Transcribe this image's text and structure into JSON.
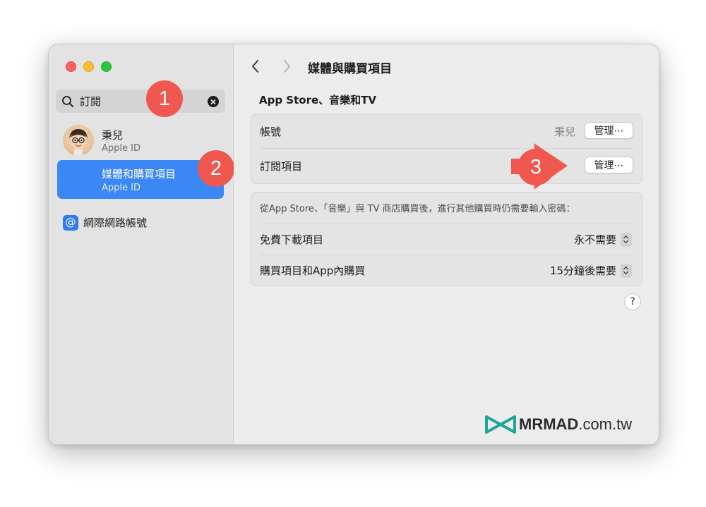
{
  "sidebar": {
    "search": {
      "value": "訂閱"
    },
    "user": {
      "name": "秉兒",
      "sub": "Apple ID"
    },
    "selected_item": {
      "title": "媒體和購買項目",
      "sub": "Apple ID"
    },
    "internet_accounts": {
      "label": "網際網路帳號",
      "icon": "@"
    }
  },
  "badges": {
    "one": "1",
    "two": "2",
    "three": "3"
  },
  "header": {
    "title": "媒體與購買項目"
  },
  "main": {
    "section_title": "App Store、音樂和TV",
    "account_row": {
      "label": "帳號",
      "value": "秉兒",
      "button": "管理⋯"
    },
    "subscriptions_row": {
      "label": "訂閱項目",
      "button": "管理⋯"
    },
    "password_desc": "從App Store、「音樂」與 TV 商店購買後，進行其他購買時仍需要輸入密碼：",
    "free_downloads": {
      "label": "免費下載項目",
      "value": "永不需要"
    },
    "purchases": {
      "label": "購買項目和App內購買",
      "value": "15分鐘後需要"
    },
    "help": "?"
  },
  "watermark": {
    "brand": "MRMAD",
    "suffix": ".com.tw"
  },
  "colors": {
    "accent": "#3b87f5",
    "badge": "#f0574f",
    "logo": "#1fa39a"
  }
}
